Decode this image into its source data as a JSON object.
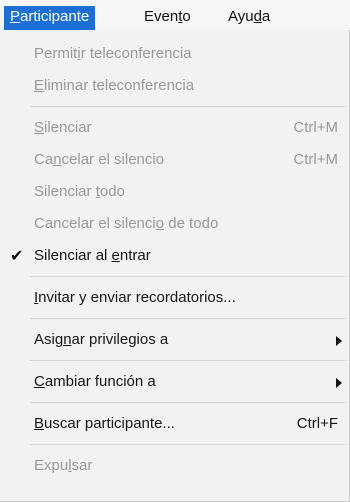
{
  "menubar": {
    "participante": {
      "pre": "",
      "u": "P",
      "post": "articipante"
    },
    "evento": {
      "pre": "Even",
      "u": "t",
      "post": "o"
    },
    "ayuda": {
      "pre": "Ayu",
      "u": "d",
      "post": "a"
    }
  },
  "menu": {
    "permitir": {
      "pre": "Permit",
      "u": "i",
      "post": "r teleconferencia"
    },
    "eliminar": {
      "pre": "",
      "u": "E",
      "post": "liminar teleconferencia"
    },
    "silenciar": {
      "pre": "",
      "u": "S",
      "post": "ilenciar",
      "shortcut": "Ctrl+M"
    },
    "cancelar_silencio": {
      "pre": "Ca",
      "u": "n",
      "post": "celar el silencio",
      "shortcut": "Ctrl+M"
    },
    "silenciar_todo": {
      "pre": "Silenciar ",
      "u": "t",
      "post": "odo"
    },
    "cancelar_silencio_todo": {
      "pre": "Cancelar el silenci",
      "u": "o",
      "post": " de todo"
    },
    "silenciar_entrar": {
      "pre": "Silenciar al ",
      "u": "e",
      "post": "ntrar"
    },
    "invitar": {
      "pre": "",
      "u": "I",
      "post": "nvitar y enviar recordatorios..."
    },
    "asignar": {
      "pre": "Asig",
      "u": "n",
      "post": "ar privilegios a"
    },
    "cambiar": {
      "pre": "",
      "u": "C",
      "post": "ambiar función a"
    },
    "buscar": {
      "pre": "",
      "u": "B",
      "post": "uscar participante...",
      "shortcut": "Ctrl+F"
    },
    "expulsar": {
      "pre": "Expu",
      "u": "l",
      "post": "sar"
    }
  },
  "icons": {
    "check": "checkmark-icon",
    "submenu": "submenu-arrow-icon"
  },
  "colors": {
    "menubar_active": "#1c6fd6",
    "enabled_text": "#161616",
    "disabled_text": "#999999",
    "menu_background": "#f2f2f2"
  }
}
